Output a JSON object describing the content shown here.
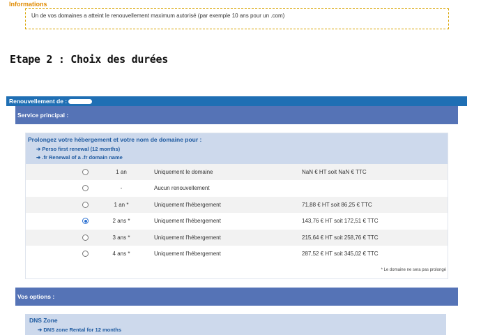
{
  "info": {
    "title": "Informations",
    "message": "Un de vos domaines a atteint le renouvellement maximum autorisé (par exemple 10 ans pour un .com)"
  },
  "step_title": "Etape 2 : Choix des durées",
  "renewal_bar": {
    "label": "Renouvellement de :"
  },
  "service": {
    "title": "Service principal :",
    "panel_title": "Prolongez votre hébergement et votre nom de domaine pour :",
    "items": [
      "➔ Perso first renewal (12 months)",
      "➔ .fr Renewal of a .fr domain name"
    ],
    "rows": [
      {
        "duration": "1 an",
        "desc": "Uniquement le domaine",
        "price": "NaN € HT soit NaN € TTC",
        "selected": false
      },
      {
        "duration": "-",
        "desc": "Aucun renouvellement",
        "price": "",
        "selected": false
      },
      {
        "duration": "1 an *",
        "desc": "Uniquement l'hébergement",
        "price": "71,88 € HT soit 86,25 € TTC",
        "selected": false
      },
      {
        "duration": "2 ans *",
        "desc": "Uniquement l'hébergement",
        "price": "143,76 € HT soit 172,51 € TTC",
        "selected": true
      },
      {
        "duration": "3 ans *",
        "desc": "Uniquement l'hébergement",
        "price": "215,64 € HT soit 258,76 € TTC",
        "selected": false
      },
      {
        "duration": "4 ans *",
        "desc": "Uniquement l'hébergement",
        "price": "287,52 € HT soit 345,02 € TTC",
        "selected": false
      }
    ],
    "footnote": "* Le domaine ne sera pas prolongé"
  },
  "options": {
    "title": "Vos options :",
    "dns_title": "DNS Zone",
    "dns_item": "➔ DNS zone Rental for 12 months"
  },
  "colors": {
    "renewal_bar": "#1f6fb4",
    "section_bar": "#5573b6",
    "panel_header": "#cdd9ec",
    "info_title": "#e08a00"
  }
}
